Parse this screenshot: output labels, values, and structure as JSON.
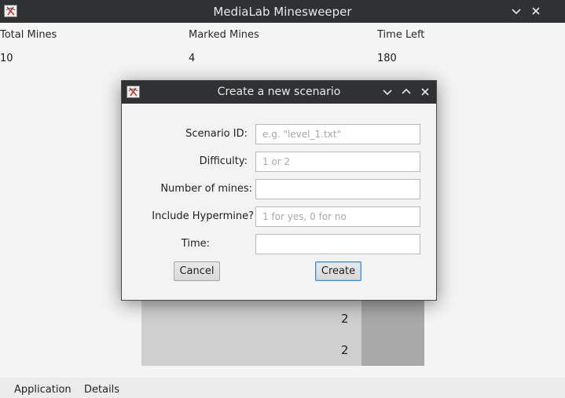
{
  "window": {
    "title": "MediaLab Minesweeper",
    "minimize_icon": "chevron-down-icon",
    "close_icon": "close-icon"
  },
  "stats": {
    "total_mines_label": "Total Mines",
    "total_mines_value": "10",
    "marked_mines_label": "Marked Mines",
    "marked_mines_value": "4",
    "time_left_label": "Time Left",
    "time_left_value": "180"
  },
  "board": {
    "cells": [
      "2",
      "2"
    ]
  },
  "menu": {
    "items": [
      "Application",
      "Details"
    ]
  },
  "dialog": {
    "title": "Create a new scenario",
    "fields": [
      {
        "label": "Scenario ID:",
        "value": "",
        "placeholder": "e.g. \"level_1.txt\""
      },
      {
        "label": "Difficulty:",
        "value": "",
        "placeholder": "1 or 2"
      },
      {
        "label": "Number of mines:",
        "value": "",
        "placeholder": ""
      },
      {
        "label": "Include Hypermine?",
        "value": "",
        "placeholder": "1 for yes, 0 for no"
      },
      {
        "label": "Time:",
        "value": "",
        "placeholder": ""
      }
    ],
    "cancel_label": "Cancel",
    "create_label": "Create"
  },
  "colors": {
    "titlebar": "#2f3133",
    "focus_accent": "#3d8fd6"
  }
}
